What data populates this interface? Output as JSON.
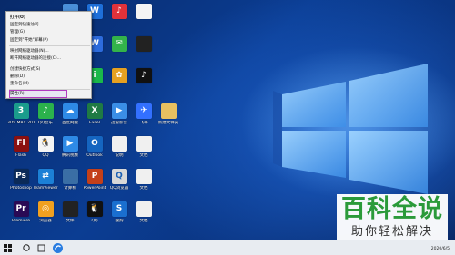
{
  "context_menu": {
    "items": [
      {
        "label": "打开(O)",
        "bold": true
      },
      {
        "label": "固定到快速访问"
      },
      {
        "label": "管理(G)"
      },
      {
        "label": "固定到\"开始\"屏幕(P)"
      },
      {
        "label": "映射网络驱动器(N)..."
      },
      {
        "label": "断开网络驱动器的连接(C)..."
      },
      {
        "label": "创建快捷方式(S)"
      },
      {
        "label": "删除(D)"
      },
      {
        "label": "重命名(M)"
      },
      {
        "label": "属性(R)"
      }
    ]
  },
  "desktop_icons": [
    {
      "label": "",
      "color": "#4a8fd8",
      "glyph": ""
    },
    {
      "label": "",
      "color": "#1e6fd9",
      "glyph": "W"
    },
    {
      "label": "",
      "color": "#e0323a",
      "glyph": "♪"
    },
    {
      "label": "",
      "color": "#f4f4f4",
      "glyph": ""
    },
    {
      "label": "",
      "color": "#2d6bdc",
      "glyph": "W"
    },
    {
      "label": "",
      "color": "#33b34a",
      "glyph": "✉"
    },
    {
      "label": "",
      "color": "#222222",
      "glyph": ""
    },
    {
      "label": "",
      "color": "#1ab84a",
      "glyph": "i"
    },
    {
      "label": "",
      "color": "#e6a020",
      "glyph": "✿"
    },
    {
      "label": "",
      "color": "#111111",
      "glyph": "♪"
    },
    {
      "label": "3DS MAX 2017",
      "color": "#1a9c8c",
      "glyph": "3"
    },
    {
      "label": "QQ音乐",
      "color": "#2bb24c",
      "glyph": "♪"
    },
    {
      "label": "百度网盘",
      "color": "#2e8ae6",
      "glyph": "☁"
    },
    {
      "label": "Excel",
      "color": "#1f7a44",
      "glyph": "X"
    },
    {
      "label": "迅雷影音",
      "color": "#3a8ee6",
      "glyph": "▶"
    },
    {
      "label": "飞书",
      "color": "#3370ff",
      "glyph": "✈"
    },
    {
      "label": "新建文件夹",
      "color": "#e8c060",
      "glyph": ""
    },
    {
      "label": "Flash",
      "color": "#8a1010",
      "glyph": "Fl"
    },
    {
      "label": "QQ",
      "color": "#f4f4f4",
      "glyph": "🐧"
    },
    {
      "label": "腾讯视频",
      "color": "#2e8ae6",
      "glyph": "▶"
    },
    {
      "label": "Outlook",
      "color": "#1565c0",
      "glyph": "O"
    },
    {
      "label": "说明",
      "color": "#f0f0f0",
      "glyph": ""
    },
    {
      "label": "文档",
      "color": "#f0f0f0",
      "glyph": ""
    },
    {
      "label": "Photoshop",
      "color": "#0b2a58",
      "glyph": "Ps"
    },
    {
      "label": "TeamViewer",
      "color": "#1c80d6",
      "glyph": "⇄"
    },
    {
      "label": "计算机",
      "color": "#3a6ea5",
      "glyph": ""
    },
    {
      "label": "PowerPoint",
      "color": "#c4401a",
      "glyph": "P"
    },
    {
      "label": "QQ浏览器",
      "color": "#d8d8d8",
      "glyph": "Q"
    },
    {
      "label": "文档",
      "color": "#f0f0f0",
      "glyph": ""
    },
    {
      "label": "Premiere",
      "color": "#2a0a55",
      "glyph": "Pr"
    },
    {
      "label": "浏览器",
      "color": "#f0a020",
      "glyph": "◎"
    },
    {
      "label": "文件",
      "color": "#222222",
      "glyph": ""
    },
    {
      "label": "QQ",
      "color": "#111111",
      "glyph": "🐧"
    },
    {
      "label": "搜狗",
      "color": "#1a6fd0",
      "glyph": "S"
    },
    {
      "label": "文档",
      "color": "#f0f0f0",
      "glyph": ""
    }
  ],
  "taskbar": {
    "date": "2020/6/5"
  },
  "watermark": {
    "title": "百科全说",
    "subtitle": "助你轻松解决"
  }
}
